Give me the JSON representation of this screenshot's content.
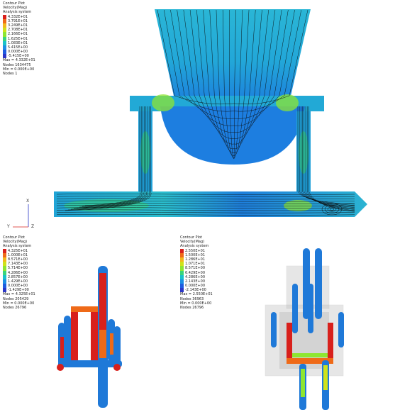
{
  "colors": {
    "scale": [
      "#d8201c",
      "#ef6a18",
      "#f2b81d",
      "#cfe21a",
      "#8ee631",
      "#39d57b",
      "#19c2c8",
      "#1c8fe4",
      "#1e5ce0",
      "#2b37c7"
    ],
    "fluid_blue": "#1f79d8",
    "fluid_cyan": "#2ab6d6",
    "streamline": "#0a0a0a",
    "solid_grey": "#b9b9b9"
  },
  "top_panel": {
    "legend": {
      "header": [
        "Contour Plot",
        "Velocity(Mag)",
        "Analysis system"
      ],
      "values": [
        "4.332E+01",
        "3.791E+01",
        "3.249E+01",
        "2.708E+01",
        "2.166E+01",
        "1.625E+01",
        "1.083E+01",
        "5.415E+00",
        "0.000E+00",
        "-5.415E+00"
      ],
      "footer": [
        "Max = 4.332E+01",
        "Nodes 1634475",
        "Min = 0.000E+00",
        "Nodes 1"
      ]
    },
    "axes": {
      "y": "Y",
      "x": "X",
      "z": "Z"
    }
  },
  "bottom_left_panel": {
    "legend": {
      "header": [
        "Contour Plot",
        "Velocity(Mag)",
        "Analysis system"
      ],
      "values": [
        "4.325E+01",
        "1.000E+01",
        "8.571E+00",
        "7.143E+00",
        "5.714E+00",
        "4.286E+00",
        "2.857E+00",
        "1.429E+00",
        "0.000E+00",
        "-1.429E+00"
      ],
      "footer": [
        "Max = 4.325E+01",
        "Nodes 205429",
        "Min = 0.000E+00",
        "Nodes 26796"
      ]
    }
  },
  "bottom_right_panel": {
    "legend": {
      "header": [
        "Contour Plot",
        "Velocity(Mag)",
        "Analysis system"
      ],
      "values": [
        "2.550E+01",
        "1.500E+01",
        "1.286E+01",
        "1.071E+01",
        "8.571E+00",
        "6.429E+00",
        "4.286E+00",
        "2.143E+00",
        "0.000E+00",
        "-2.143E+00"
      ],
      "footer": [
        "Max = 2.550E+01",
        "Nodes 36963",
        "Min = 0.000E+00",
        "Nodes 26796"
      ]
    }
  }
}
